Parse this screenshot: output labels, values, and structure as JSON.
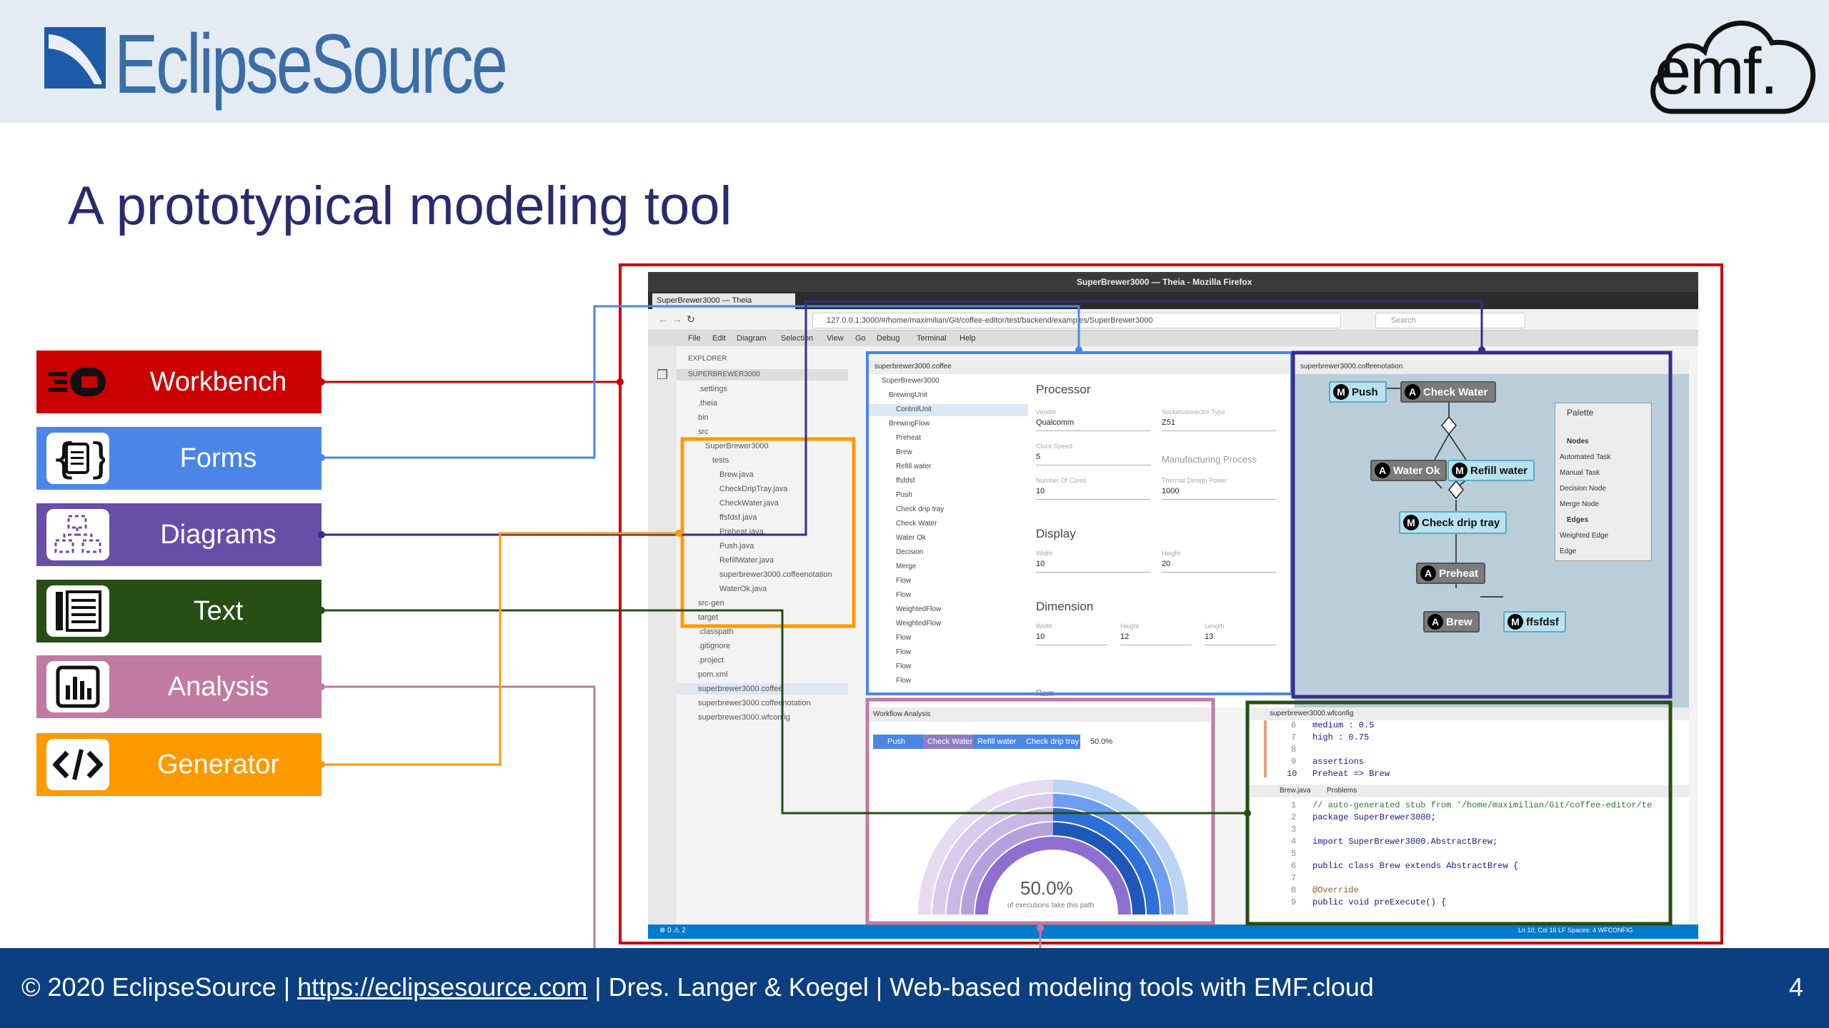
{
  "header": {
    "brand": "EclipseSource",
    "logo_right": "emf."
  },
  "title": "A prototypical modeling tool",
  "buttons": [
    {
      "label": "Workbench",
      "color": "#cc0000",
      "icon": "workbench-icon"
    },
    {
      "label": "Forms",
      "color": "#4a86e8",
      "icon": "form-braces-icon"
    },
    {
      "label": "Diagrams",
      "color": "#674ea7",
      "icon": "diagram-icon"
    },
    {
      "label": "Text",
      "color": "#274e13",
      "icon": "text-editor-icon"
    },
    {
      "label": "Analysis",
      "color": "#c27ba0",
      "icon": "bar-chart-icon"
    },
    {
      "label": "Generator",
      "color": "#ff9900",
      "icon": "code-icon"
    }
  ],
  "footer": {
    "prefix": "© 2020 EclipseSource | ",
    "link": "https://eclipsesource.com",
    "suffix": " | Dres. Langer & Koegel | Web-based modeling tools with EMF.cloud",
    "page": "4"
  },
  "shot": {
    "window_title": "SuperBrewer3000 — Theia - Mozilla Firefox",
    "tab": "SuperBrewer3000 — Theia",
    "url": "127.0.0.1:3000/#/home/maximilian/Git/coffee-editor/test/backend/examples/SuperBrewer3000",
    "search": "Search",
    "menu": [
      "File",
      "Edit",
      "Diagram",
      "Selection",
      "View",
      "Go",
      "Debug",
      "Terminal",
      "Help"
    ],
    "explorer": {
      "title": "EXPLORER",
      "root": "SUPERBREWER3000",
      "items": [
        ".settings",
        ".theia",
        "bin",
        "src",
        "SuperBrewer3000",
        "tests",
        "Brew.java",
        "CheckDripTray.java",
        "CheckWater.java",
        "ffsfdsf.java",
        "Preheat.java",
        "Push.java",
        "RefillWater.java",
        "superbrewer3000.coffeenotation",
        "WaterOk.java",
        "src-gen",
        "target",
        ".classpath",
        ".gitignore",
        ".project",
        "pom.xml",
        "superbrewer3000.coffee",
        "superbrewer3000.coffeenotation",
        "superbrewer3000.wfconfig"
      ]
    },
    "coffee_tab": "superbrewer3000.coffee",
    "coffee_tree": [
      "SuperBrewer3000",
      "BrewingUnit",
      "ControlUnit",
      "BrewingFlow",
      "Preheat",
      "Brew",
      "Refill water",
      "ffsfdsf",
      "Push",
      "Check drip tray",
      "Check Water",
      "Water Ok",
      "Decision",
      "Merge",
      "Flow",
      "Flow",
      "WeightedFlow",
      "WeightedFlow",
      "Flow",
      "Flow",
      "Flow",
      "Flow"
    ],
    "form": {
      "processor": "Processor",
      "vendor_label": "Vendor",
      "vendor": "Qualcomm",
      "socket_label": "Socketconnector Type",
      "socket": "Z51",
      "clock_label": "Clock Speed",
      "clock": "5",
      "manufacturing": "Manufacturing Process",
      "cores_label": "Number Of Cores",
      "cores": "10",
      "tdp_label": "Thermal Design Power",
      "tdp": "1000",
      "display": "Display",
      "width_label": "Width",
      "width": "10",
      "height_label": "Height",
      "height": "20",
      "dimension": "Dimension",
      "d_width": "10",
      "d_height": "12",
      "length_label": "Length",
      "d_length": "13",
      "ram": "Ram"
    },
    "diagram_tab": "superbrewer3000.coffeenotation",
    "diagram": {
      "push": "Push",
      "check_water": "Check Water",
      "water_ok": "Water Ok",
      "refill_water": "Refill water",
      "check_drip": "Check drip tray",
      "preheat": "Preheat",
      "brew": "Brew",
      "ffsfdsf": "ffsfdsf"
    },
    "palette": {
      "title": "Palette",
      "nodes": "Nodes",
      "node_items": [
        "Automated Task",
        "Manual Task",
        "Decision Node",
        "Merge Node"
      ],
      "edges": "Edges",
      "edge_items": [
        "Weighted Edge",
        "Edge"
      ]
    },
    "analysis_tab": "Workflow Analysis",
    "analysis_steps": [
      "Push",
      "Check Water",
      "Refill water",
      "Check drip tray"
    ],
    "analysis_pct": "50.0%",
    "analysis_big": "50.0%",
    "analysis_sub": "of executions take this path",
    "wfconfig_tab": "superbrewer3000.wfconfig",
    "wfconfig_lines": [
      [
        "6",
        "medium : 0.5"
      ],
      [
        "7",
        "high   : 0.75"
      ],
      [
        "8",
        ""
      ],
      [
        "9",
        "assertions"
      ],
      [
        "10",
        "Preheat => Brew"
      ]
    ],
    "java_tab": "Brew.java",
    "problems_tab": "Problems",
    "java_lines": [
      [
        "1",
        "// auto-generated stub from '/home/maximilian/Git/coffee-editor/te"
      ],
      [
        "2",
        "package SuperBrewer3000;"
      ],
      [
        "3",
        ""
      ],
      [
        "4",
        "import SuperBrewer3000.AbstractBrew;"
      ],
      [
        "5",
        ""
      ],
      [
        "6",
        "public class Brew extends AbstractBrew {"
      ],
      [
        "7",
        ""
      ],
      [
        "8",
        "    @Override"
      ],
      [
        "9",
        "    public void preExecute() {"
      ]
    ],
    "status_left": "⊗ 0 ⚠ 2",
    "status_right": "Ln 10, Col 16   LF   Spaces: 4   WFCONFIG"
  }
}
